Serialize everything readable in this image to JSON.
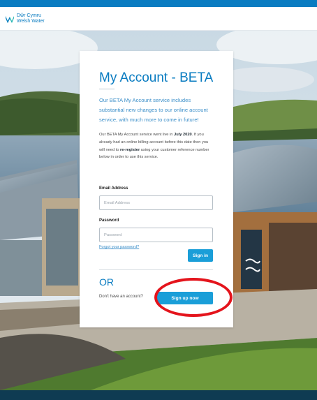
{
  "brand": {
    "name_cy": "Dŵr Cymru",
    "name_en": "Welsh Water",
    "color_primary": "#0a7cc1",
    "color_button": "#1a9ed8",
    "color_highlight": "#e4141c"
  },
  "card": {
    "title": "My Account - BETA",
    "lead": "Our BETA My Account service includes substantial new changes to our online account service, with much more to come in future!",
    "body_1": "Our BETA My Account service went live in ",
    "body_date": "July 2020",
    "body_2": ". If you already had an online billing account before this date then you will need to ",
    "body_register": "re-register",
    "body_3": " using your customer reference number below in order to use this service.",
    "email_label": "Email Address",
    "email_placeholder": "Email Address",
    "email_value": "",
    "password_label": "Password",
    "password_placeholder": "Password",
    "password_value": "",
    "forgot_link": "Forgot your password?",
    "signin_button": "Sign in",
    "or_text": "OR",
    "no_account_text": "Don't have an account?",
    "signup_button": "Sign up now"
  },
  "icons": {
    "logo": "welsh-water-logo-icon"
  }
}
